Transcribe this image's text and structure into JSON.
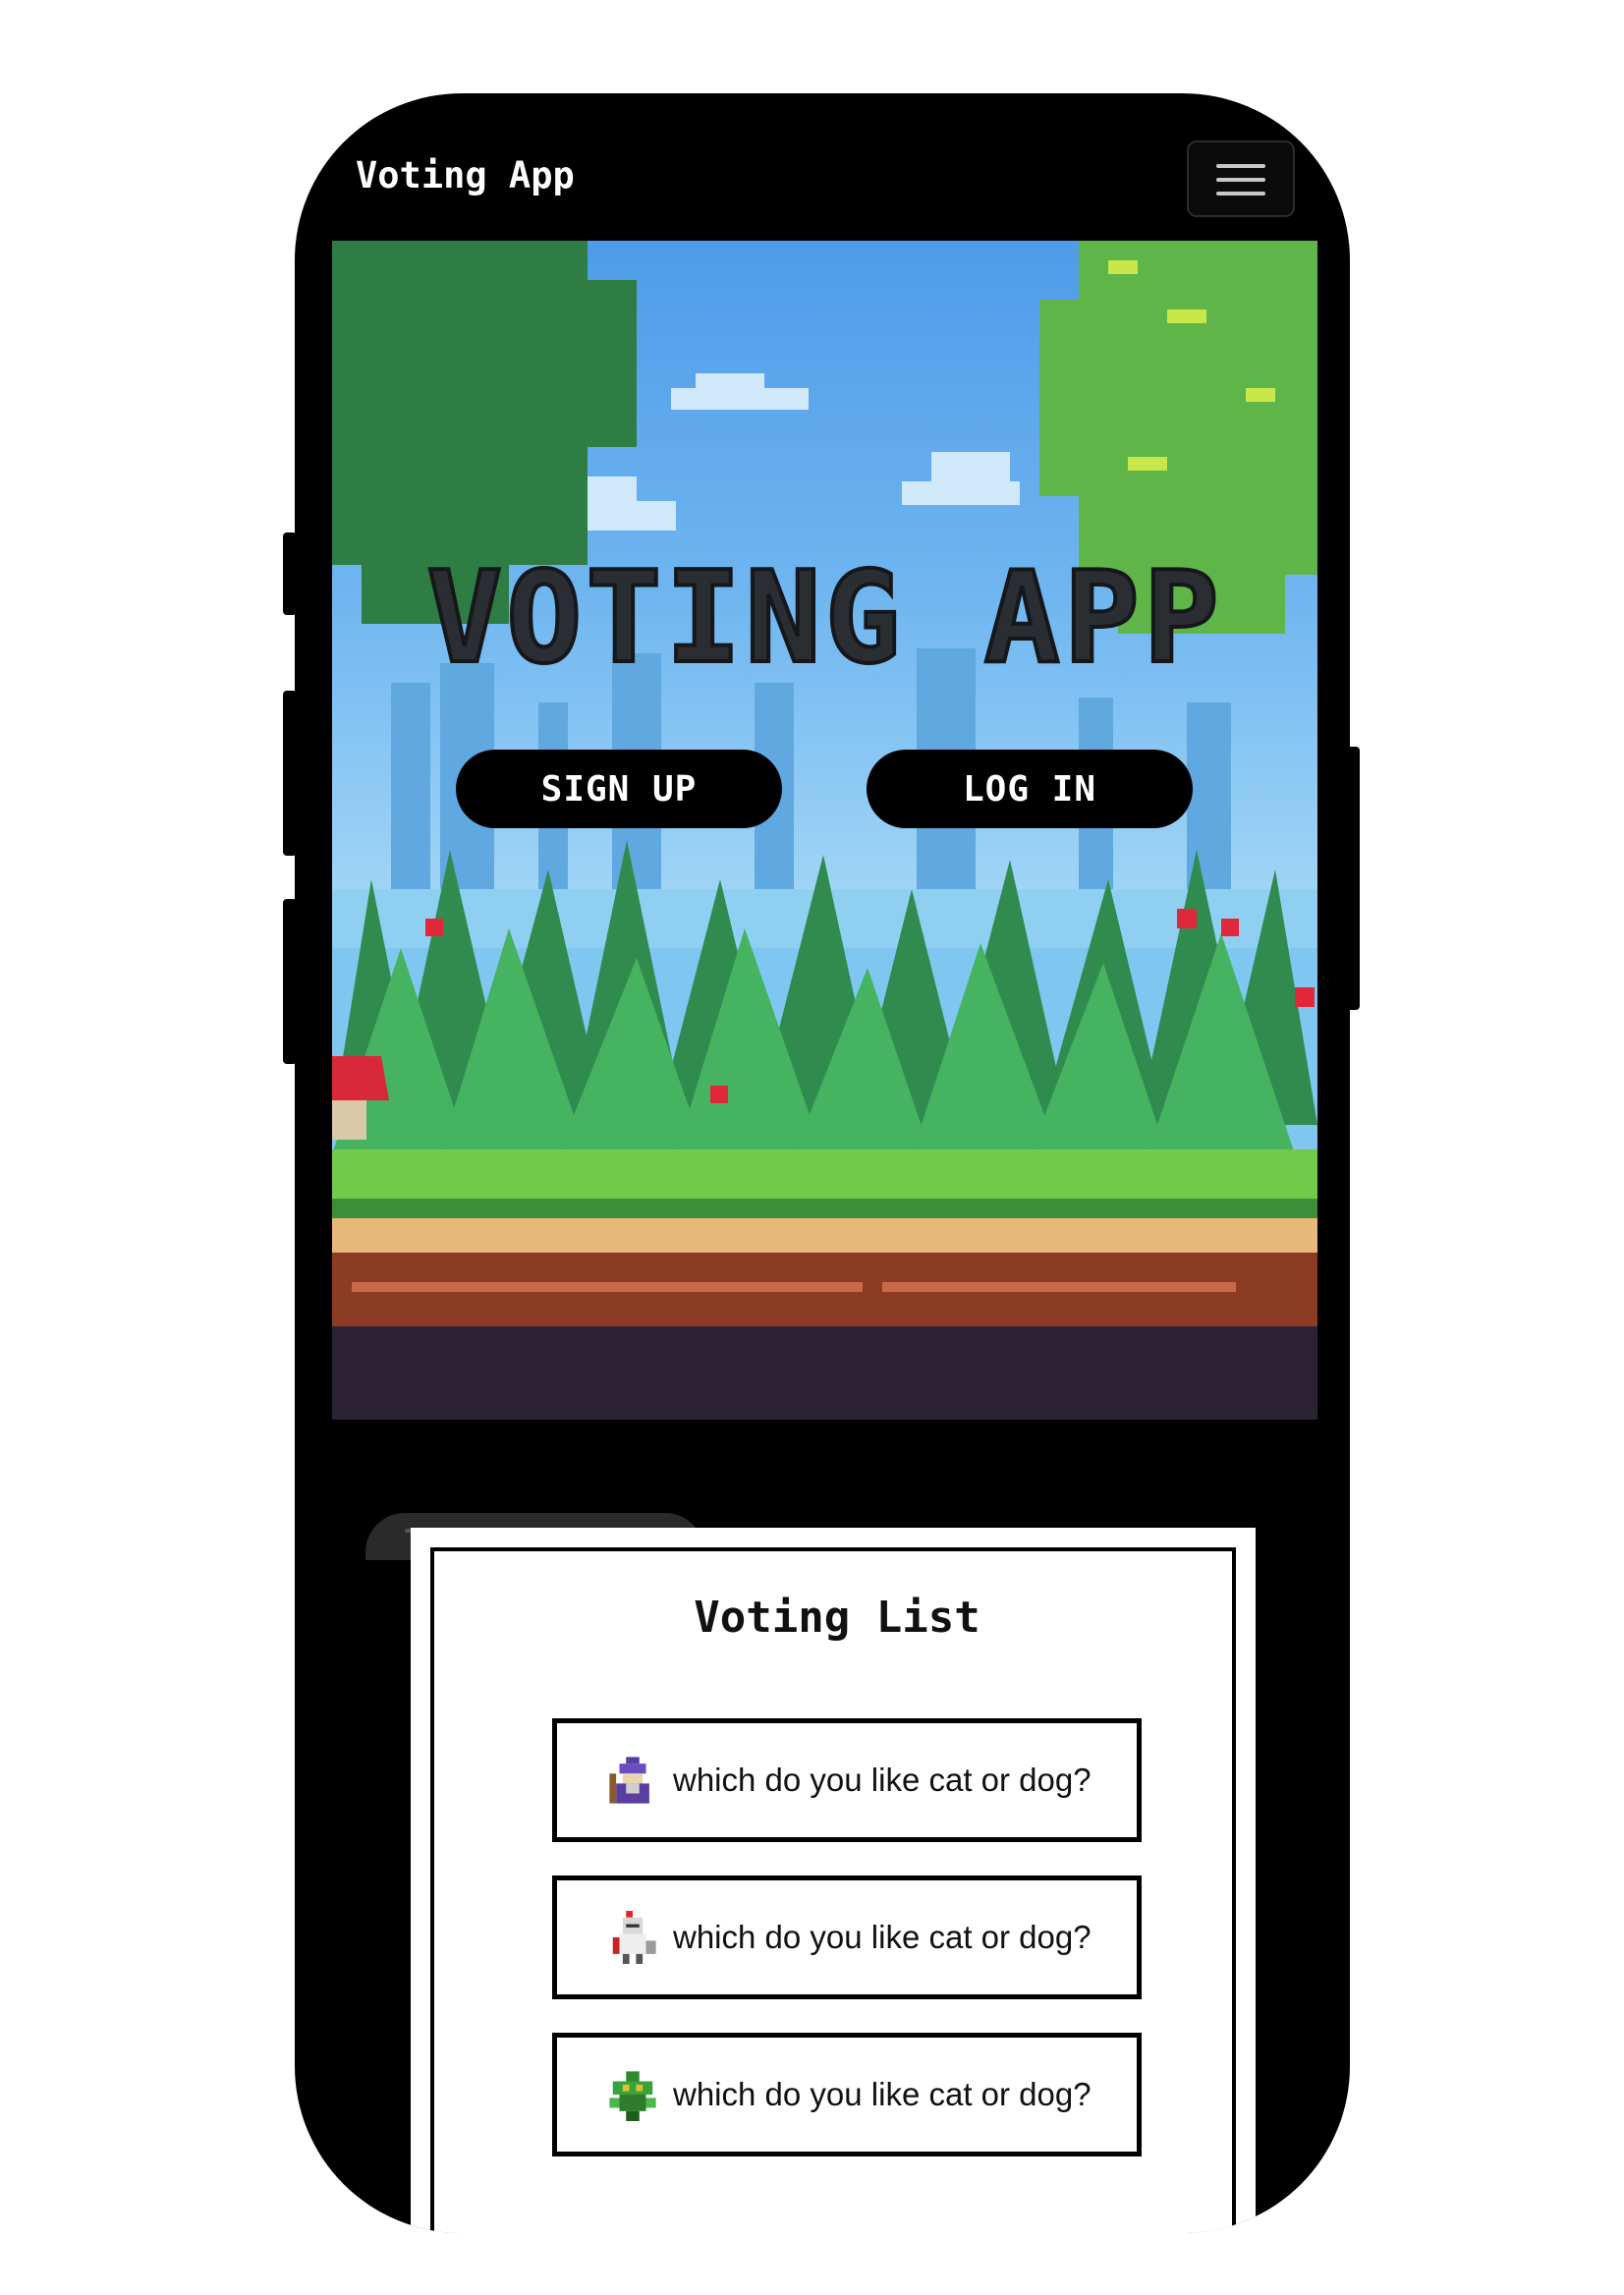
{
  "navbar": {
    "brand": "Voting App",
    "menu_icon": "hamburger-menu-icon"
  },
  "hero": {
    "title": "VOTING APP",
    "signup_label": "SIGN UP",
    "login_label": "LOG IN"
  },
  "voting_list": {
    "title": "Voting List",
    "items": [
      {
        "question": "which do you like cat or dog?",
        "icon": "wizard-sprite-icon"
      },
      {
        "question": "which do you like cat or dog?",
        "icon": "knight-sprite-icon"
      },
      {
        "question": "which do you like cat or dog?",
        "icon": "plant-monster-sprite-icon"
      }
    ]
  },
  "colors": {
    "phone_frame": "#000000",
    "button_bg": "#000000",
    "title_text": "#2a2d32"
  }
}
